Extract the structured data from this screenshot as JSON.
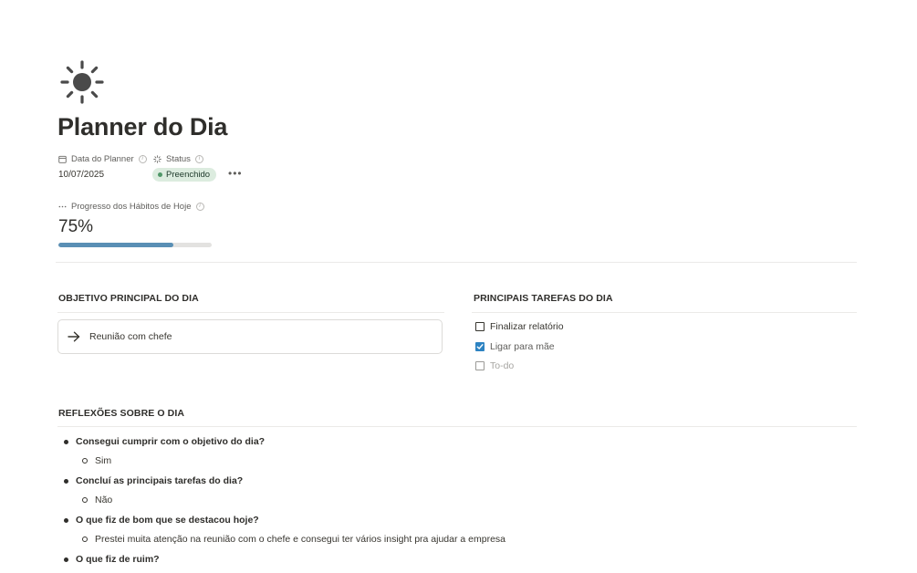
{
  "page": {
    "icon": "sun-icon",
    "title": "Planner do Dia"
  },
  "properties": {
    "date": {
      "label": "Data do Planner",
      "icon": "calendar-icon",
      "value": "10/07/2025"
    },
    "status": {
      "label": "Status",
      "icon": "status-icon",
      "value": "Preenchido",
      "color": "#dcecdf"
    },
    "more": "•••",
    "progress": {
      "label": "Progresso dos Hábitos de Hoje",
      "icon": "list-dots-icon",
      "value_text": "75%",
      "fraction": 0.75,
      "bar_color": "#5a8fb5"
    }
  },
  "objective": {
    "heading": "OBJETIVO PRINCIPAL DO DIA",
    "text": "Reunião com chefe",
    "icon": "arrow-right-icon"
  },
  "tasks": {
    "heading": "PRINCIPAIS TAREFAS DO DIA",
    "items": [
      {
        "label": "Finalizar relatório",
        "checked": false
      },
      {
        "label": "Ligar para mãe",
        "checked": true
      },
      {
        "label": "To-do",
        "checked": false,
        "placeholder": true
      }
    ],
    "check_color": "#2d83c2"
  },
  "reflections": {
    "heading": "REFLEXÕES SOBRE O DIA",
    "items": [
      {
        "question": "Consegui cumprir com o objetivo do dia?",
        "answer": "Sim"
      },
      {
        "question": "Concluí as principais tarefas do dia?",
        "answer": "Não"
      },
      {
        "question": "O que fiz de bom que se destacou hoje?",
        "answer": "Prestei muita atenção na reunião com o chefe e consegui ter vários insight pra ajudar a empresa"
      },
      {
        "question": "O que fiz de ruim?"
      }
    ]
  }
}
